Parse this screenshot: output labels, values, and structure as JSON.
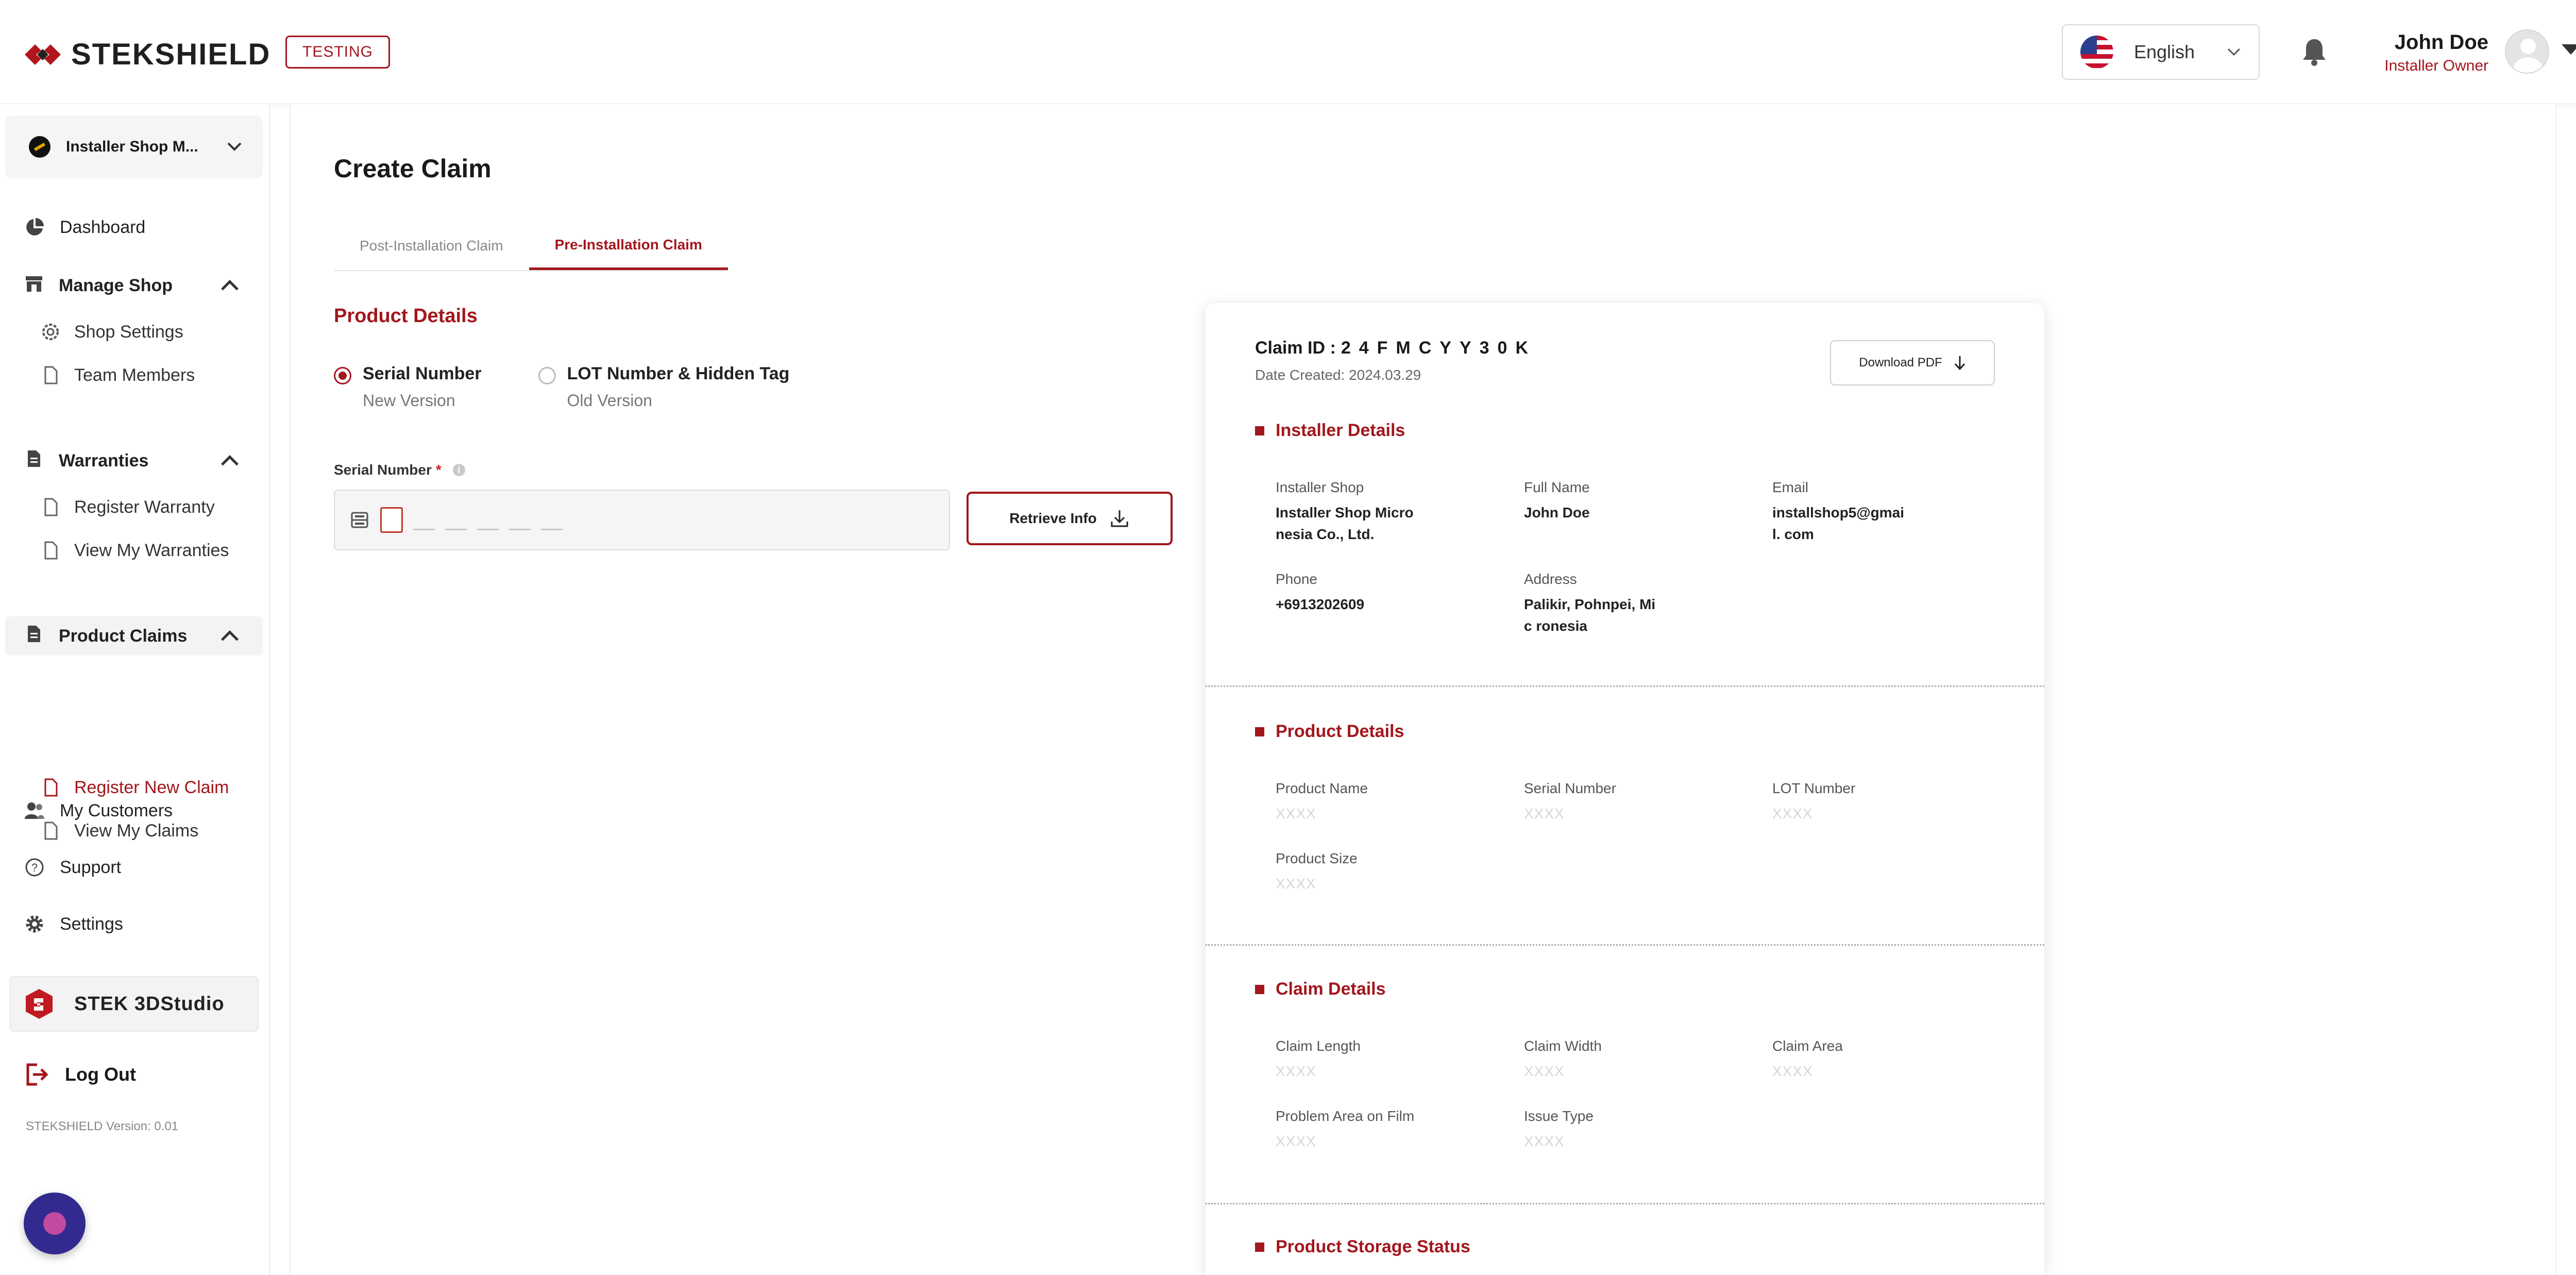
{
  "header": {
    "logo_text": "STEKSHIELD",
    "env_badge": "TESTING",
    "language": "English",
    "user_name": "John Doe",
    "user_role": "Installer Owner"
  },
  "sidebar": {
    "shop_name": "Installer Shop M...",
    "dashboard": "Dashboard",
    "manage_shop": "Manage Shop",
    "shop_settings": "Shop Settings",
    "team_members": "Team Members",
    "warranties": "Warranties",
    "register_warranty": "Register Warranty",
    "view_warranties": "View My Warranties",
    "product_claims": "Product Claims",
    "register_claim": "Register New Claim",
    "view_claims": "View My Claims",
    "my_customers": "My Customers",
    "support": "Support",
    "settings": "Settings",
    "studio": "STEK 3DStudio",
    "logout": "Log Out",
    "version": "STEKSHIELD Version: 0.01"
  },
  "main": {
    "title": "Create Claim",
    "tabs": [
      "Post-Installation Claim",
      "Pre-Installation Claim"
    ],
    "product_details_title": "Product Details",
    "radio_options": [
      {
        "title": "Serial Number",
        "sub": "New Version",
        "selected": true
      },
      {
        "title": "LOT Number & Hidden Tag",
        "sub": "Old Version",
        "selected": false
      }
    ],
    "serial_label": "Serial Number",
    "required_mark": "*",
    "retrieve_label": "Retrieve Info"
  },
  "card": {
    "claim_id_label": "Claim ID :",
    "claim_id": "24FMCYY30K",
    "date_created": "Date Created: 2024.03.29",
    "download_pdf": "Download PDF",
    "installer_title": "Installer Details",
    "installer": [
      {
        "k": "Installer Shop",
        "v": "Installer Shop Micro nesia Co., Ltd."
      },
      {
        "k": "Full Name",
        "v": "John Doe"
      },
      {
        "k": "Email",
        "v": "installshop5@gmail. com"
      },
      {
        "k": "Phone",
        "v": "+6913202609"
      },
      {
        "k": "Address",
        "v": "Palikir, Pohnpei, Mic ronesia"
      }
    ],
    "product_title": "Product Details",
    "product": [
      {
        "k": "Product Name",
        "v": "XXXX"
      },
      {
        "k": "Serial Number",
        "v": "XXXX"
      },
      {
        "k": "LOT Number",
        "v": "XXXX"
      },
      {
        "k": "Product Size",
        "v": "XXXX"
      }
    ],
    "claim_title": "Claim Details",
    "claim": [
      {
        "k": "Claim Length",
        "v": "XXXX"
      },
      {
        "k": "Claim Width",
        "v": "XXXX"
      },
      {
        "k": "Claim Area",
        "v": "XXXX"
      },
      {
        "k": "Problem Area on Film",
        "v": "XXXX"
      },
      {
        "k": "Issue Type",
        "v": "XXXX"
      }
    ],
    "storage_title": "Product Storage Status"
  },
  "colors": {
    "brand": "#a3161d",
    "text": "#1a1a1a"
  }
}
